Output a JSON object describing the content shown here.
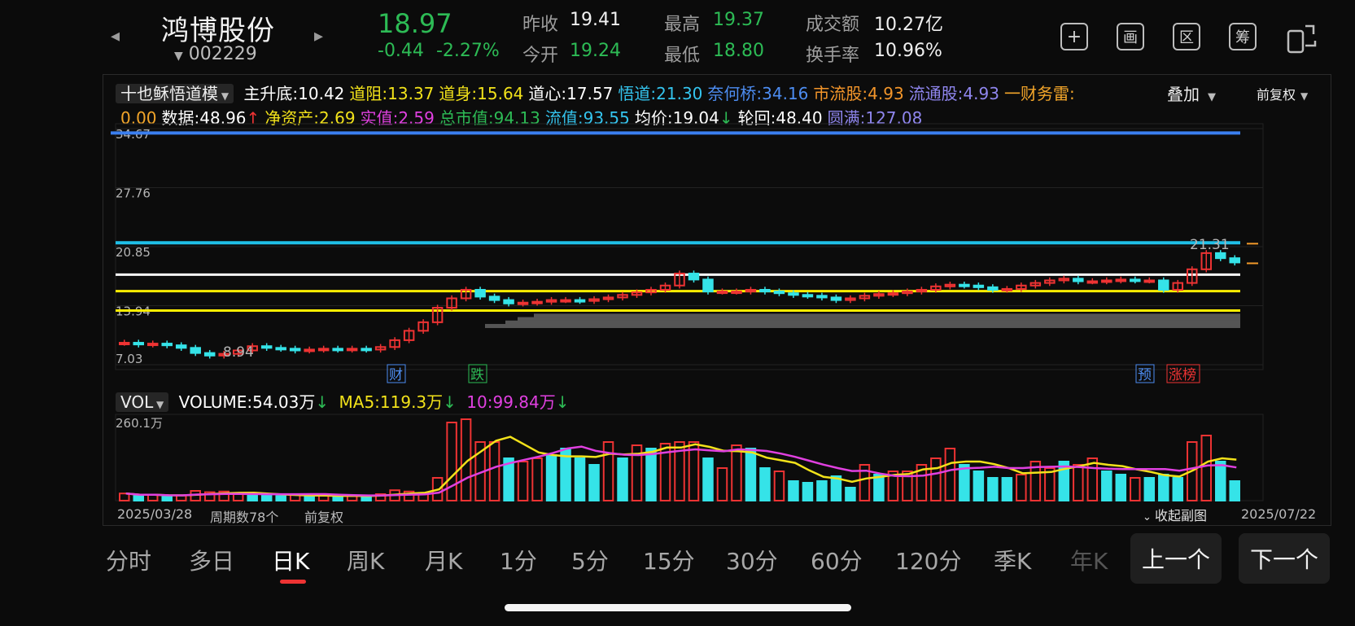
{
  "header": {
    "stock_name": "鸿博股份",
    "stock_code": "002229",
    "price": "18.97",
    "change": "-0.44",
    "change_pct": "-2.27%",
    "stats": [
      {
        "label": "昨收",
        "value": "19.41",
        "color": "white"
      },
      {
        "label": "今开",
        "value": "19.24",
        "color": "green"
      },
      {
        "label": "最高",
        "value": "19.37",
        "color": "green"
      },
      {
        "label": "最低",
        "value": "18.80",
        "color": "green"
      },
      {
        "label": "成交额",
        "value": "10.27亿",
        "color": "white"
      },
      {
        "label": "换手率",
        "value": "10.96%",
        "color": "white"
      }
    ],
    "tools": [
      "+",
      "画",
      "区",
      "筹"
    ]
  },
  "indicator": {
    "name": "十也稣悟道模",
    "items_row1": [
      {
        "label": "主升底:10.42",
        "color": "#ffffff"
      },
      {
        "label": "道阻:13.37",
        "color": "#f2e21a"
      },
      {
        "label": "道身:15.64",
        "color": "#f2e21a"
      },
      {
        "label": "道心:17.57",
        "color": "#ffffff"
      },
      {
        "label": "悟道:21.30",
        "color": "#34c4ee"
      },
      {
        "label": "奈何桥:34.16",
        "color": "#4d8df2"
      },
      {
        "label": "市流股:4.93",
        "color": "#f2952a"
      },
      {
        "label": "流通股:4.93",
        "color": "#8f86ee"
      },
      {
        "label": "一财务雷:",
        "color": "#f2a52a"
      }
    ],
    "items_row2": [
      {
        "label": "0.00",
        "color": "#f2a52a"
      },
      {
        "label": "数据:48.96",
        "color": "#ffffff"
      },
      {
        "label": "↑",
        "color": "#ee3333"
      },
      {
        "label": "净资产:2.69",
        "color": "#f2e21a"
      },
      {
        "label": "实值:2.59",
        "color": "#e040e0"
      },
      {
        "label": "总市值:94.13",
        "color": "#2dbb55"
      },
      {
        "label": "流值:93.55",
        "color": "#34c4ee"
      },
      {
        "label": "均价:19.04",
        "color": "#ffffff"
      },
      {
        "label": "↓",
        "color": "#2dbb55"
      },
      {
        "label": "轮回:48.40",
        "color": "#ffffff"
      },
      {
        "label": "圆满:127.08",
        "color": "#8f86ee"
      }
    ],
    "overlay": "叠加",
    "adjust": "前复权"
  },
  "kline": {
    "y_ticks": [
      "34.67",
      "27.76",
      "20.85",
      "13.94",
      "7.03"
    ],
    "min_label": "8.94",
    "max_label": "21.31",
    "markers": [
      {
        "text": "财",
        "color": "#4d8df2"
      },
      {
        "text": "跌",
        "color": "#2dbb55"
      },
      {
        "text": "预",
        "color": "#4d8df2"
      },
      {
        "text": "涨榜",
        "color": "#ee3333"
      }
    ],
    "levels": [
      {
        "name": "奈何桥",
        "value": 34.16,
        "color": "#3a7ff0"
      },
      {
        "name": "悟道",
        "value": 21.3,
        "color": "#1fc0e8"
      },
      {
        "name": "道心",
        "value": 17.57,
        "color": "#ffffff"
      },
      {
        "name": "道身",
        "value": 15.64,
        "color": "#ffee00"
      },
      {
        "name": "道阻",
        "value": 13.37,
        "color": "#ffee00"
      }
    ]
  },
  "volume": {
    "name": "VOL",
    "volume_label": "VOLUME:54.03万",
    "ma5_label": "MA5:119.3万",
    "ma10_label": "10:99.84万",
    "arrow": "↓",
    "y_max_label": "260.1万",
    "bars": [
      22,
      14,
      18,
      12,
      16,
      30,
      26,
      28,
      20,
      18,
      16,
      14,
      18,
      14,
      16,
      12,
      14,
      16,
      20,
      32,
      28,
      24,
      70,
      240,
      250,
      180,
      180,
      130,
      120,
      130,
      140,
      160,
      130,
      110,
      180,
      130,
      170,
      160,
      175,
      180,
      180,
      130,
      100,
      170,
      160,
      100,
      90,
      60,
      55,
      60,
      75,
      40,
      110,
      80,
      90,
      90,
      110,
      130,
      160,
      110,
      90,
      70,
      70,
      80,
      120,
      100,
      120,
      110,
      130,
      90,
      80,
      70,
      70,
      80,
      70,
      180,
      200,
      120,
      60
    ],
    "up": [
      1,
      0,
      1,
      0,
      1,
      1,
      1,
      1,
      1,
      0,
      0,
      0,
      1,
      0,
      1,
      0,
      1,
      0,
      1,
      1,
      1,
      1,
      1,
      1,
      1,
      1,
      1,
      0,
      1,
      1,
      0,
      0,
      0,
      0,
      1,
      0,
      1,
      0,
      1,
      1,
      1,
      0,
      1,
      1,
      0,
      0,
      1,
      0,
      0,
      0,
      0,
      0,
      1,
      0,
      1,
      1,
      1,
      1,
      1,
      0,
      0,
      0,
      0,
      1,
      1,
      1,
      0,
      1,
      1,
      0,
      0,
      1,
      0,
      0,
      0,
      1,
      1,
      0,
      0
    ]
  },
  "chart_data": {
    "type": "bar",
    "title": "",
    "x_start": "2025/03/28",
    "x_end": "2025/07/22",
    "period_count_label": "周期数78个",
    "adjust_label": "前复权",
    "collapse_label": "收起副图",
    "ylim": [
      7.03,
      34.67
    ],
    "closes": [
      9.6,
      9.4,
      9.5,
      9.3,
      9.0,
      8.4,
      8.1,
      8.3,
      8.7,
      9.2,
      9.0,
      8.9,
      8.7,
      8.8,
      8.9,
      8.8,
      8.9,
      8.8,
      9.1,
      9.9,
      11.0,
      12.0,
      13.7,
      14.8,
      15.8,
      15.0,
      14.6,
      14.2,
      14.3,
      14.4,
      14.6,
      14.6,
      14.5,
      14.7,
      14.9,
      15.2,
      15.5,
      15.8,
      16.3,
      17.7,
      17.0,
      15.6,
      15.6,
      15.6,
      15.8,
      15.6,
      15.4,
      15.2,
      15.1,
      14.9,
      14.6,
      14.8,
      15.1,
      15.3,
      15.4,
      15.6,
      15.8,
      16.2,
      16.4,
      16.3,
      16.1,
      15.8,
      15.9,
      16.3,
      16.6,
      16.9,
      17.1,
      16.8,
      16.8,
      16.9,
      17.0,
      16.9,
      16.9,
      15.8,
      16.6,
      18.2,
      20.1,
      19.5,
      19.0
    ],
    "volume_ma5_label": "MA5:119.3万",
    "volume_ma10_label": "10:99.84万"
  },
  "bottom_tabs": [
    "分时",
    "多日",
    "日K",
    "周K",
    "月K",
    "1分",
    "5分",
    "15分",
    "30分",
    "60分",
    "120分",
    "季K",
    "年K"
  ],
  "active_tab": "日K",
  "nav": {
    "prev": "上一个",
    "next": "下一个"
  }
}
